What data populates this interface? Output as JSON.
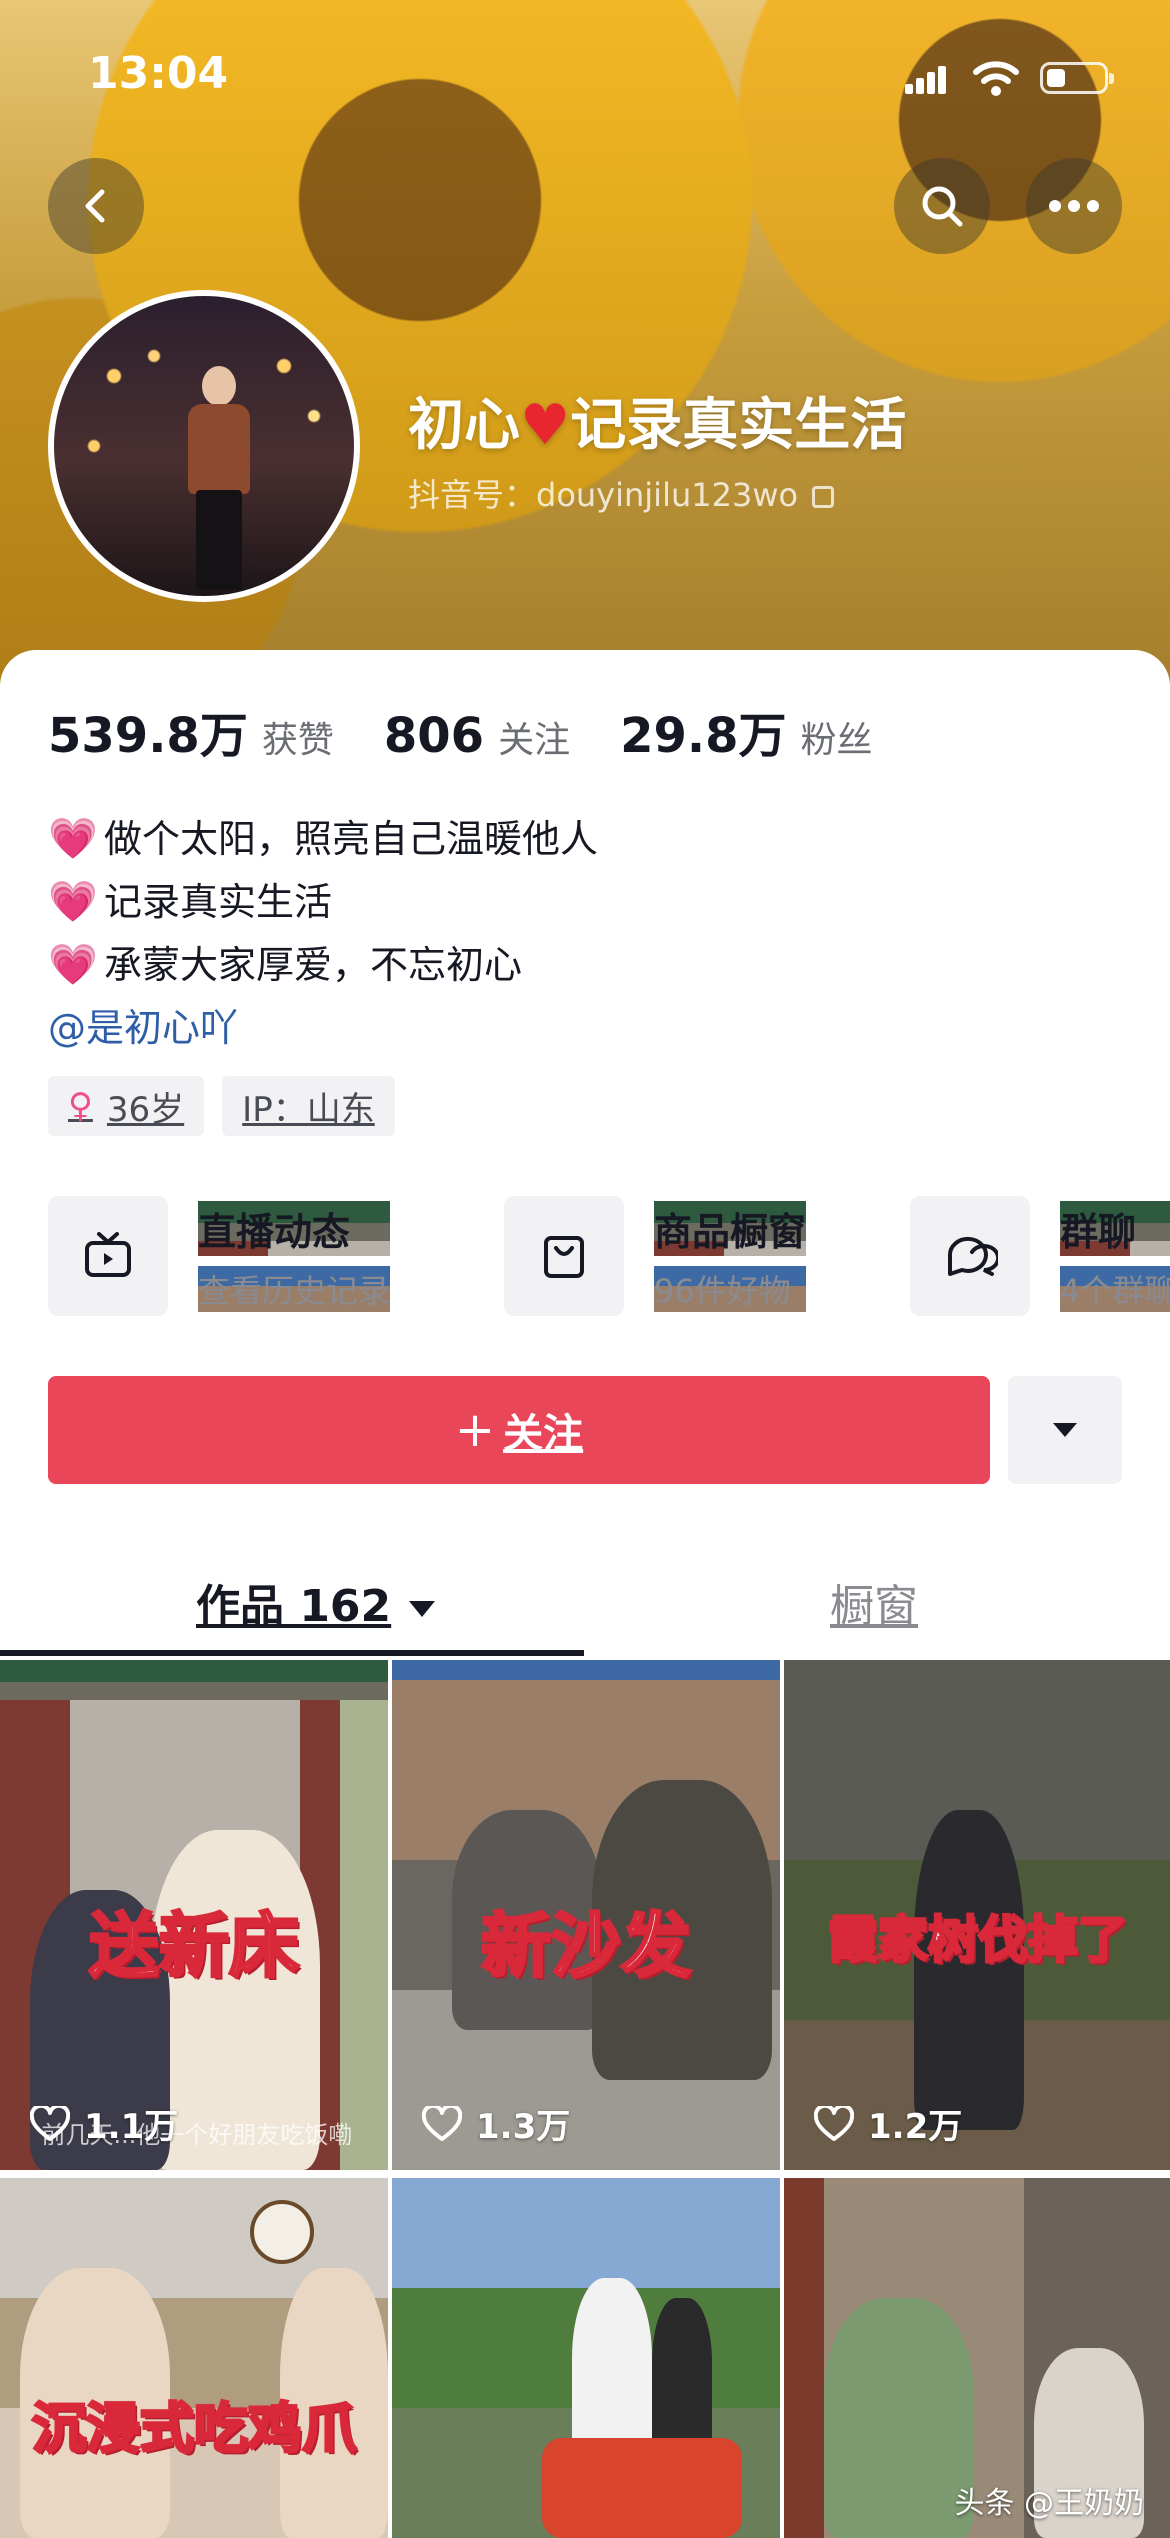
{
  "status_bar": {
    "time": "13:04"
  },
  "profile": {
    "nickname_part1": "初心",
    "nickname_heart": "♥",
    "nickname_part2": "记录真实生活",
    "douyin_id": "抖音号：douyinjilu123wo"
  },
  "stats": [
    {
      "value": "539.8万",
      "label": "获赞"
    },
    {
      "value": "806",
      "label": "关注"
    },
    {
      "value": "29.8万",
      "label": "粉丝"
    }
  ],
  "bio": {
    "lines": [
      "做个太阳，照亮自己温暖他人",
      "记录真实生活",
      "承蒙大家厚爱，不忘初心"
    ],
    "mention": "@是初心吖"
  },
  "tags": {
    "age": "36岁",
    "ip": "IP：山东"
  },
  "services": [
    {
      "title": "直播动态",
      "subtitle": "查看历史记录",
      "icon": "tv-icon"
    },
    {
      "title": "商品橱窗",
      "subtitle": "96件好物",
      "icon": "shopping-bag-icon"
    },
    {
      "title": "群聊",
      "subtitle": "4个群聊",
      "icon": "chat-bubbles-icon"
    }
  ],
  "actions": {
    "follow_plus": "+",
    "follow_label": "关注"
  },
  "tabs": {
    "works": "作品 162",
    "shop": "橱窗"
  },
  "videos": [
    {
      "caption": "送新床",
      "likes": "1.1万",
      "subtitle": "前几天...他一个好朋友吃饭嘞"
    },
    {
      "caption": "新沙发",
      "likes": "1.3万"
    },
    {
      "caption": "霞家树伐掉了",
      "likes": "1.2万"
    },
    {
      "caption": "沉浸式吃鸡爪"
    },
    {
      "caption": ""
    },
    {
      "caption": ""
    }
  ],
  "watermark": "头条 @王奶奶",
  "colors": {
    "accent": "#e9465a",
    "mention": "#2f5ea8",
    "heart": "#e8262f"
  }
}
